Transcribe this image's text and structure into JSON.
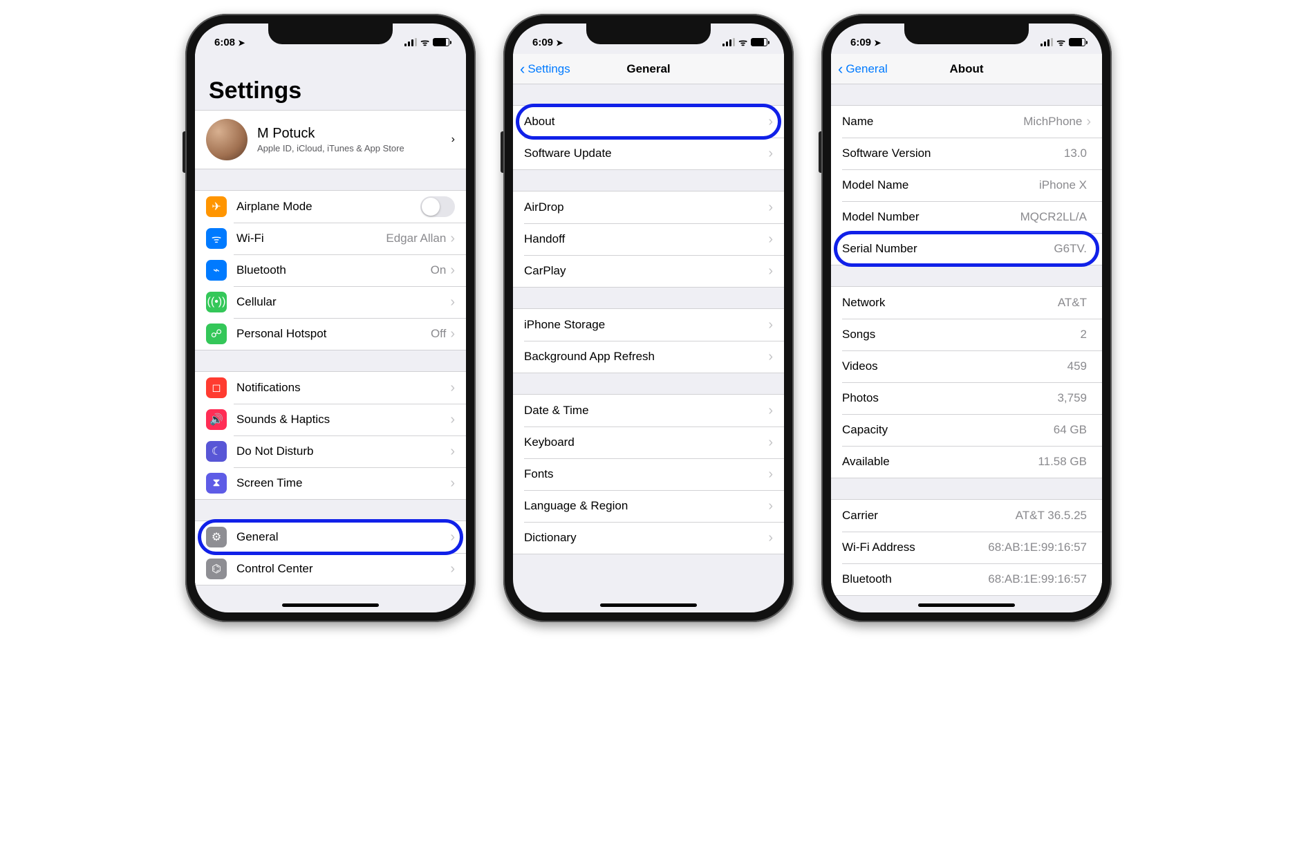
{
  "phone1": {
    "time": "6:08",
    "title": "Settings",
    "apple_id": {
      "name": "M Potuck",
      "subtitle": "Apple ID, iCloud, iTunes & App Store"
    },
    "group_network": [
      {
        "label": "Airplane Mode",
        "icon": "airplane-icon",
        "color": "c-orange",
        "toggle": true
      },
      {
        "label": "Wi-Fi",
        "icon": "wifi-icon",
        "color": "c-blue",
        "value": "Edgar Allan",
        "chevron": true
      },
      {
        "label": "Bluetooth",
        "icon": "bluetooth-icon",
        "color": "c-blue",
        "value": "On",
        "chevron": true
      },
      {
        "label": "Cellular",
        "icon": "cellular-icon",
        "color": "c-green",
        "chevron": true
      },
      {
        "label": "Personal Hotspot",
        "icon": "hotspot-icon",
        "color": "c-green",
        "value": "Off",
        "chevron": true
      }
    ],
    "group_prefs": [
      {
        "label": "Notifications",
        "icon": "notifications-icon",
        "color": "c-red",
        "chevron": true
      },
      {
        "label": "Sounds & Haptics",
        "icon": "sounds-icon",
        "color": "c-pink",
        "chevron": true
      },
      {
        "label": "Do Not Disturb",
        "icon": "dnd-icon",
        "color": "c-purple",
        "chevron": true
      },
      {
        "label": "Screen Time",
        "icon": "screentime-icon",
        "color": "c-indigo",
        "chevron": true
      }
    ],
    "group_general": [
      {
        "label": "General",
        "icon": "general-icon",
        "color": "c-grey",
        "chevron": true,
        "highlight": true
      },
      {
        "label": "Control Center",
        "icon": "control-center-icon",
        "color": "c-grey",
        "chevron": true
      }
    ]
  },
  "phone2": {
    "time": "6:09",
    "back": "Settings",
    "title": "General",
    "group1": [
      {
        "label": "About",
        "chevron": true,
        "highlight": true
      },
      {
        "label": "Software Update",
        "chevron": true
      }
    ],
    "group2": [
      {
        "label": "AirDrop",
        "chevron": true
      },
      {
        "label": "Handoff",
        "chevron": true
      },
      {
        "label": "CarPlay",
        "chevron": true
      }
    ],
    "group3": [
      {
        "label": "iPhone Storage",
        "chevron": true
      },
      {
        "label": "Background App Refresh",
        "chevron": true
      }
    ],
    "group4": [
      {
        "label": "Date & Time",
        "chevron": true
      },
      {
        "label": "Keyboard",
        "chevron": true
      },
      {
        "label": "Fonts",
        "chevron": true
      },
      {
        "label": "Language & Region",
        "chevron": true
      },
      {
        "label": "Dictionary",
        "chevron": true
      }
    ]
  },
  "phone3": {
    "time": "6:09",
    "back": "General",
    "title": "About",
    "group1": [
      {
        "label": "Name",
        "value": "MichPhone",
        "chevron": true
      },
      {
        "label": "Software Version",
        "value": "13.0"
      },
      {
        "label": "Model Name",
        "value": "iPhone X"
      },
      {
        "label": "Model Number",
        "value": "MQCR2LL/A"
      },
      {
        "label": "Serial Number",
        "value": "G6TV.",
        "highlight": true
      }
    ],
    "group2": [
      {
        "label": "Network",
        "value": "AT&T"
      },
      {
        "label": "Songs",
        "value": "2"
      },
      {
        "label": "Videos",
        "value": "459"
      },
      {
        "label": "Photos",
        "value": "3,759"
      },
      {
        "label": "Capacity",
        "value": "64 GB"
      },
      {
        "label": "Available",
        "value": "11.58 GB"
      }
    ],
    "group3": [
      {
        "label": "Carrier",
        "value": "AT&T 36.5.25"
      },
      {
        "label": "Wi-Fi Address",
        "value": "68:AB:1E:99:16:57"
      },
      {
        "label": "Bluetooth",
        "value": "68:AB:1E:99:16:57"
      }
    ]
  },
  "icons": {
    "airplane-icon": "✈︎",
    "wifi-icon": "ᯤ",
    "bluetooth-icon": "⌁",
    "cellular-icon": "((•))",
    "hotspot-icon": "☍",
    "notifications-icon": "◻︎",
    "sounds-icon": "🔊",
    "dnd-icon": "☾",
    "screentime-icon": "⧗",
    "general-icon": "⚙︎",
    "control-center-icon": "⌬",
    "location-arrow": "➤"
  }
}
